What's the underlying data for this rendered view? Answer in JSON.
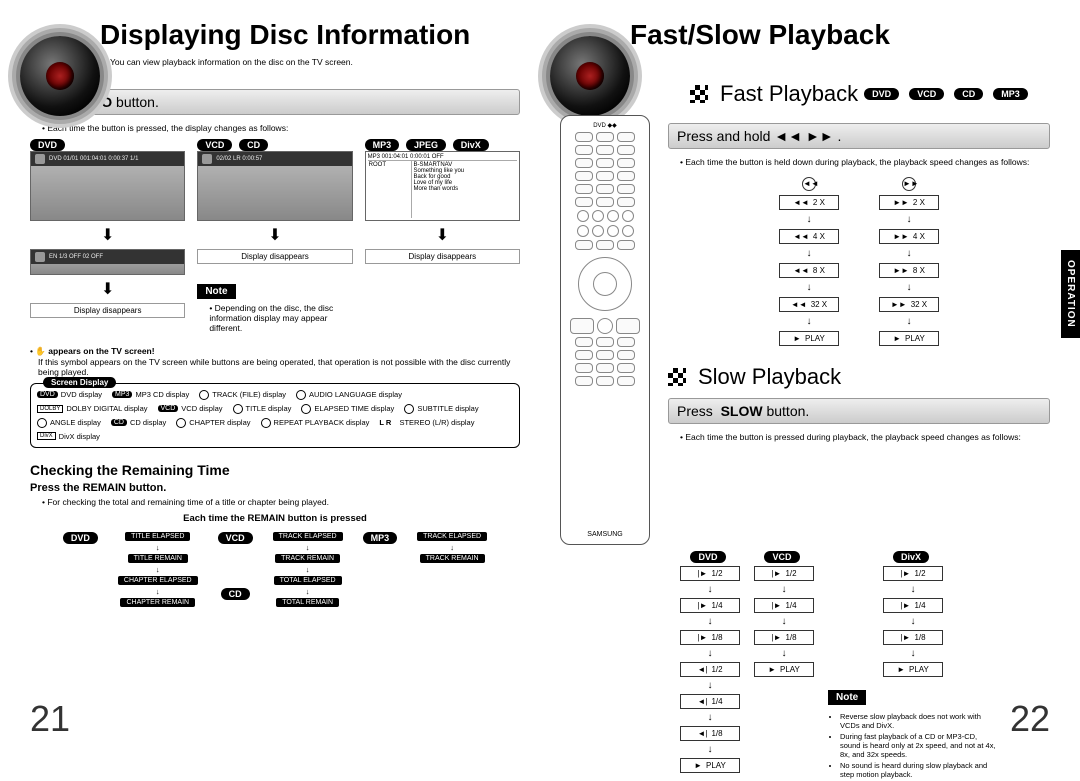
{
  "left": {
    "title": "Displaying Disc Information",
    "subtitle": "You can view playback information on the disc on the TV screen.",
    "bar1": "Press INFO button.",
    "bar1_strong": "INFO",
    "bullet1": "Each time the button is pressed, the display changes as follows:",
    "labels": {
      "dvd": "DVD",
      "vcd": "VCD",
      "cd": "CD",
      "mp3": "MP3",
      "jpeg": "JPEG",
      "divx": "DivX"
    },
    "disdis": "Display disappears",
    "note": "Note",
    "note_text": "Depending on the disc, the disc information display may appear different.",
    "hand_line": "appears on the TV screen!",
    "hand_body": "If this symbol appears on the TV screen while buttons are being operated, that operation is not possible with the disc currently being played.",
    "sd_label": "Screen Display",
    "legend": {
      "dvd": "DVD display",
      "mp3": "MP3 CD display",
      "track": "TRACK (FILE) display",
      "audio": "AUDIO LANGUAGE display",
      "dolby": "DOLBY DIGITAL display",
      "vcd": "VCD display",
      "title": "TITLE display",
      "elapsed": "ELAPSED TIME display",
      "subtitle": "SUBTITLE display",
      "angle": "ANGLE display",
      "cd": "CD display",
      "chapter": "CHAPTER display",
      "repeat": "REPEAT PLAYBACK display",
      "stereo": "STEREO (L/R) display",
      "divx": "DivX display",
      "lr": "L R"
    },
    "check_title": "Checking the Remaining Time",
    "check_sub": "Press the REMAIN button.",
    "check_bul": "For checking the total and remaining time of a title or chapter being played.",
    "check_each": "Each time the REMAIN button is pressed",
    "remain": {
      "dvd": [
        "TITLE ELAPSED",
        "TITLE REMAIN",
        "CHAPTER ELAPSED",
        "CHAPTER REMAIN"
      ],
      "vcd_cd": [
        "TRACK ELAPSED",
        "TRACK REMAIN",
        "TOTAL ELAPSED",
        "TOTAL REMAIN"
      ],
      "mp3": [
        "TRACK ELAPSED",
        "TRACK REMAIN"
      ]
    },
    "pagenum": "21"
  },
  "right": {
    "title": "Fast/Slow Playback",
    "fast_title": "Fast Playback",
    "fast_pills": [
      "DVD",
      "VCD",
      "CD",
      "MP3"
    ],
    "bar1": "Press and hold",
    "bullet1": "Each time the button is held down during playback, the playback speed changes as follows:",
    "rew_icon": "◄◄",
    "fwd_icon": "►►",
    "play": "PLAY",
    "speeds": [
      "2 X",
      "4 X",
      "8 X",
      "32 X"
    ],
    "slow_title": "Slow Playback",
    "bar2": "Press  SLOW button.",
    "bar2_strong": "SLOW",
    "bullet2": "Each time the button is pressed during playback, the playback speed changes as follows:",
    "slow_pills": [
      "DVD",
      "VCD",
      "DivX"
    ],
    "slow_dvd": [
      "1/2",
      "1/4",
      "1/8",
      "1/2",
      "1/4",
      "1/8"
    ],
    "slow_vcd": [
      "1/2",
      "1/4",
      "1/8"
    ],
    "slow_divx": [
      "1/2",
      "1/4",
      "1/8"
    ],
    "note": "Note",
    "notes": [
      "Reverse slow playback does not work with VCDs and DivX.",
      "During fast playback of a CD or MP3-CD, sound is heard only at 2x speed, and not at 4x, 8x, and 32x speeds.",
      "No sound is heard during slow playback and step motion playback."
    ],
    "side_tab": "OPERATION",
    "pagenum": "22"
  }
}
